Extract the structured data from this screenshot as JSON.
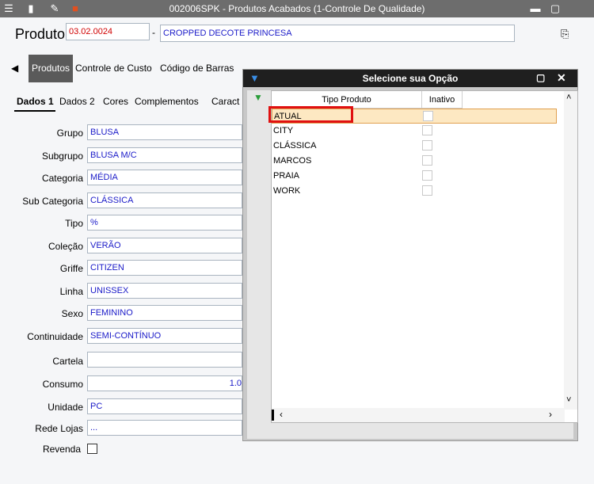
{
  "window": {
    "title": "002006SPK - Produtos Acabados (1-Controle De Qualidade)"
  },
  "header": {
    "label": "Produto",
    "code": "03.02.0024",
    "separator": "-",
    "description": "CROPPED DECOTE PRINCESA"
  },
  "tabs": [
    "Produtos",
    "Controle de Custo",
    "Código de Barras"
  ],
  "subtabs": [
    "Dados 1",
    "Dados 2",
    "Cores",
    "Complementos",
    "Caract"
  ],
  "fields": [
    {
      "label": "Grupo",
      "value": "BLUSA"
    },
    {
      "label": "Subgrupo",
      "value": "BLUSA M/C"
    },
    {
      "label": "Categoria",
      "value": "MÉDIA"
    },
    {
      "label": "Sub Categoria",
      "value": "CLÁSSICA"
    },
    {
      "label": "Tipo",
      "value": "%"
    },
    {
      "label": "Coleção",
      "value": "VERÃO"
    },
    {
      "label": "Griffe",
      "value": "CITIZEN"
    },
    {
      "label": "Linha",
      "value": "UNISSEX"
    },
    {
      "label": "Sexo",
      "value": "FEMININO"
    },
    {
      "label": "Continuidade",
      "value": "SEMI-CONTÍNUO"
    },
    {
      "label": "Cartela",
      "value": ""
    },
    {
      "label": "Consumo",
      "value": "1.0"
    },
    {
      "label": "Unidade",
      "value": "PC"
    },
    {
      "label": "Rede Lojas",
      "value": "..."
    }
  ],
  "revenda": {
    "label": "Revenda"
  },
  "popup": {
    "title": "Selecione sua Opção",
    "columns": [
      "Tipo Produto",
      "Inativo"
    ],
    "rows": [
      "ATUAL",
      "CITY",
      "CLÁSSICA",
      "MARCOS",
      "PRAIA",
      "WORK"
    ],
    "selected": "ATUAL"
  }
}
